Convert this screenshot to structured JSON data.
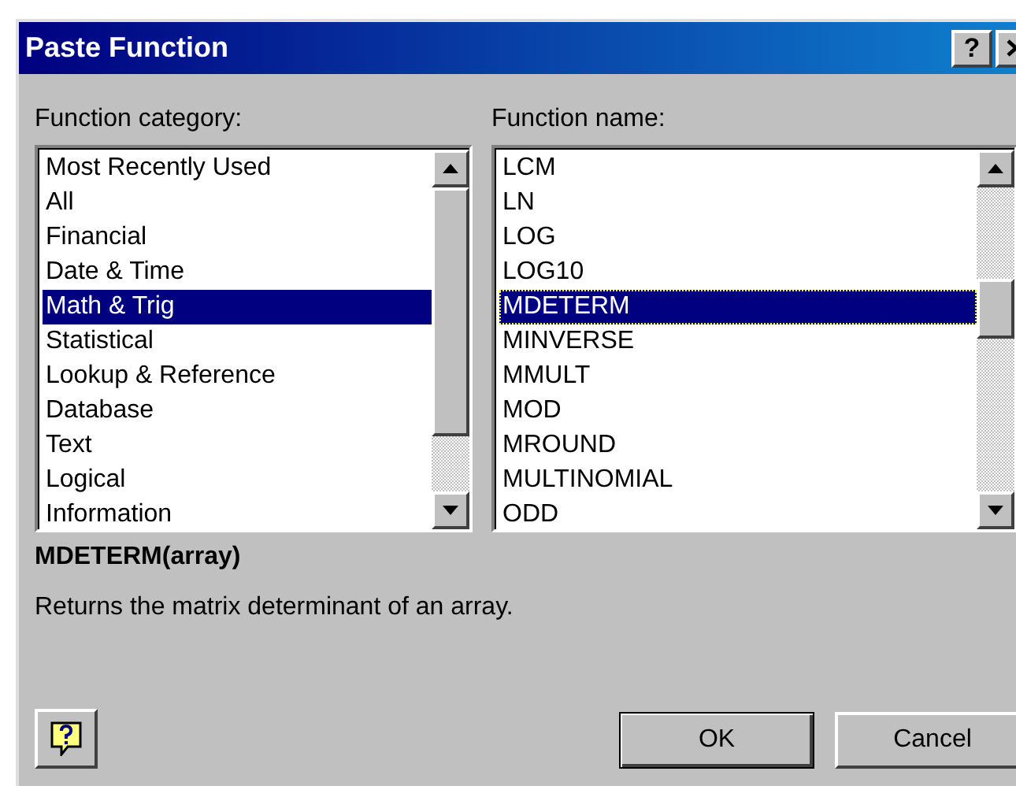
{
  "window": {
    "title": "Paste Function",
    "help_button": "?"
  },
  "category_list": {
    "label": "Function category:",
    "items": [
      {
        "label": "Most Recently Used",
        "selected": false
      },
      {
        "label": "All",
        "selected": false
      },
      {
        "label": "Financial",
        "selected": false
      },
      {
        "label": "Date & Time",
        "selected": false
      },
      {
        "label": "Math & Trig",
        "selected": true
      },
      {
        "label": "Statistical",
        "selected": false
      },
      {
        "label": "Lookup & Reference",
        "selected": false
      },
      {
        "label": "Database",
        "selected": false
      },
      {
        "label": "Text",
        "selected": false
      },
      {
        "label": "Logical",
        "selected": false
      },
      {
        "label": "Information",
        "selected": false
      }
    ]
  },
  "function_list": {
    "label": "Function name:",
    "items": [
      {
        "label": "LCM",
        "selected": false
      },
      {
        "label": "LN",
        "selected": false
      },
      {
        "label": "LOG",
        "selected": false
      },
      {
        "label": "LOG10",
        "selected": false
      },
      {
        "label": "MDETERM",
        "selected": true
      },
      {
        "label": "MINVERSE",
        "selected": false
      },
      {
        "label": "MMULT",
        "selected": false
      },
      {
        "label": "MOD",
        "selected": false
      },
      {
        "label": "MROUND",
        "selected": false
      },
      {
        "label": "MULTINOMIAL",
        "selected": false
      },
      {
        "label": "ODD",
        "selected": false
      }
    ]
  },
  "syntax": "MDETERM(array)",
  "description": "Returns the matrix determinant of an array.",
  "buttons": [
    "OK",
    "Cancel"
  ]
}
